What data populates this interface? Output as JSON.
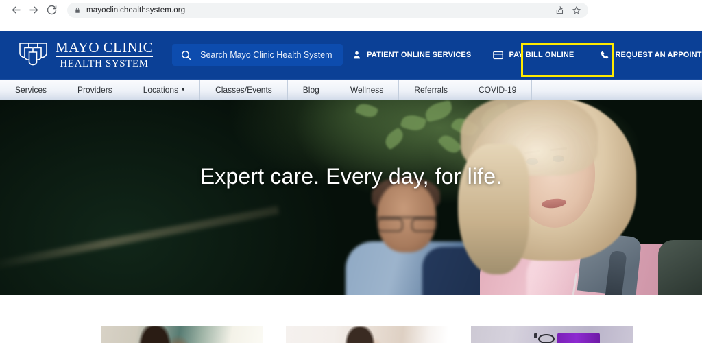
{
  "browser": {
    "back_icon": "back-arrow-icon",
    "forward_icon": "forward-arrow-icon",
    "reload_icon": "reload-icon",
    "lock_icon": "lock-icon",
    "url": "mayoclinichealthsystem.org",
    "share_icon": "share-icon",
    "bookmark_icon": "bookmark-star-icon"
  },
  "header": {
    "logo": {
      "shield_icon": "mayo-clinic-shields-icon",
      "line1": "MAYO CLINIC",
      "line2": "HEALTH SYSTEM"
    },
    "search": {
      "icon": "search-icon",
      "placeholder": "Search Mayo Clinic Health System"
    },
    "actions": [
      {
        "label": "PATIENT ONLINE SERVICES",
        "icon": "person-icon"
      },
      {
        "label": "PAY BILL ONLINE",
        "icon": "credit-card-icon"
      },
      {
        "label": "REQUEST AN APPOINTMENT",
        "icon": "phone-icon"
      }
    ],
    "highlight": {
      "target_label": "PAY BILL ONLINE",
      "color": "#ffeb00"
    },
    "background_color": "#0b4096"
  },
  "subnav": {
    "items": [
      {
        "label": "Services",
        "has_caret": false
      },
      {
        "label": "Providers",
        "has_caret": false
      },
      {
        "label": "Locations",
        "has_caret": true,
        "caret": "▾"
      },
      {
        "label": "Classes/Events",
        "has_caret": false
      },
      {
        "label": "Blog",
        "has_caret": false
      },
      {
        "label": "Wellness",
        "has_caret": false
      },
      {
        "label": "Referrals",
        "has_caret": false
      },
      {
        "label": "COVID-19",
        "has_caret": false
      }
    ]
  },
  "hero": {
    "headline": "Expert care. Every day, for life.",
    "image_description": "Smiling older couple hiking outdoors under green foliage; man in blue jacket, woman with blonde hair in pink jacket with backpack"
  },
  "cards": [
    {
      "name": "card-one",
      "image_description": "Woman with dark hair in a bright interior"
    },
    {
      "name": "card-two",
      "image_description": "Woman with dark hair against a light neutral background"
    },
    {
      "name": "card-three",
      "image_description": "Stethoscope and purple smartphone on a light surface"
    }
  ]
}
